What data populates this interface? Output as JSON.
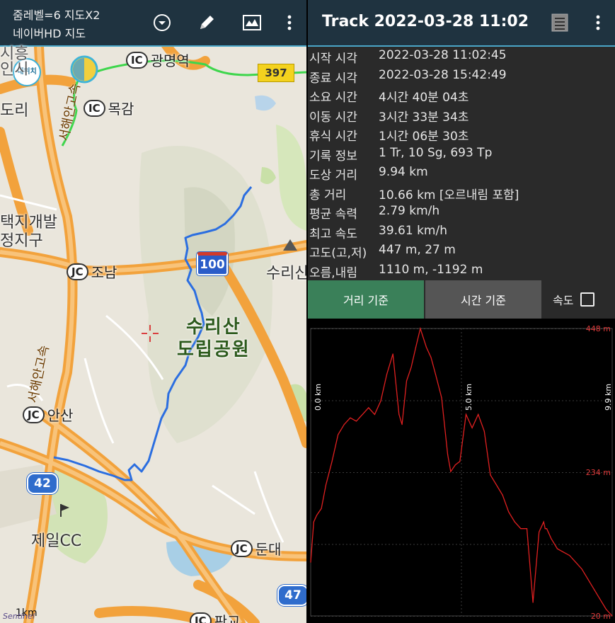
{
  "map": {
    "toolbar": {
      "zoom_text": "줌레벨=6 지도X2",
      "map_name": "네이버HD 지도",
      "icons": [
        "dropdown-circle-icon",
        "pencil-icon",
        "map-picture-icon",
        "more-vert-icon"
      ]
    },
    "my_location_label": "내위치",
    "labels": {
      "gwangmyeong_ic": "광명역",
      "mokgam_ic": "목감",
      "jonam_jc": "조남",
      "ansan_jc": "안산",
      "dundae_jc": "둔대",
      "pangyo_jc": "판교",
      "ic": "IC",
      "jc": "JC",
      "suri_park": "수리산\n도립공원",
      "suri_mountain": "수리산",
      "jeil_cc": "제일CC",
      "dev_zone": "택지개발\n정지구",
      "siheung": "시흥\n인시",
      "dori": "도리",
      "seohae_expressway_1": "서해안고속",
      "seohae_expressway_2": "서해안고속",
      "route_397": "397",
      "route_100": "100",
      "route_42": "42",
      "route_47": "47",
      "scale": "1km",
      "watermark": "Sentinel"
    }
  },
  "track": {
    "title": "Track 2022-03-28 11:02",
    "icons": [
      "list-document-icon",
      "more-vert-icon"
    ],
    "stats": [
      {
        "label": "시작 시각",
        "value": "2022-03-28 11:02:45"
      },
      {
        "label": "종료 시각",
        "value": "2022-03-28 15:42:49"
      },
      {
        "label": "소요 시간",
        "value": "4시간 40분 04초"
      },
      {
        "label": "이동 시간",
        "value": "3시간 33분 34초"
      },
      {
        "label": "휴식 시간",
        "value": "1시간 06분 30초"
      },
      {
        "label": "기록 정보",
        "value": "1 Tr, 10 Sg, 693 Tp"
      },
      {
        "label": "도상 거리",
        "value": "9.94 km"
      },
      {
        "label": "총 거리",
        "value": "10.66 km [오르내림 포함]"
      },
      {
        "label": "평균 속력",
        "value": "2.79 km/h"
      },
      {
        "label": "최고 속도",
        "value": "39.61 km/h"
      },
      {
        "label": "고도(고,저)",
        "value": "447 m, 27 m"
      },
      {
        "label": "오름,내림",
        "value": "1110 m, -1192 m"
      }
    ],
    "tabs": {
      "distance": "거리 기준",
      "time": "시간 기준",
      "speed": "속도",
      "speed_checked": false,
      "active": "distance"
    },
    "colors": {
      "accent": "#3a8059",
      "toolbar": "#1f3340",
      "line": "#e02020"
    }
  },
  "chart_data": {
    "type": "line",
    "title": "",
    "xlabel": "",
    "ylabel": "",
    "x_tick_labels": [
      "0.0 km",
      "5.0 km",
      "9.9 km"
    ],
    "y_tick_labels": [
      "448 m",
      "234 m",
      "20 m"
    ],
    "xlim": [
      0,
      9.9
    ],
    "ylim": [
      20,
      448
    ],
    "grid": true,
    "series": [
      {
        "x": [
          0.0,
          0.1,
          0.2,
          0.35,
          0.5,
          0.7,
          0.9,
          1.1,
          1.3,
          1.5,
          1.7,
          1.9,
          2.1,
          2.3,
          2.5,
          2.7,
          2.9,
          3.0,
          3.15,
          3.3,
          3.45,
          3.6,
          3.8,
          3.95,
          4.1,
          4.3,
          4.5,
          4.6,
          4.75,
          4.9,
          5.1,
          5.3,
          5.5,
          5.7,
          5.9,
          6.1,
          6.3,
          6.5,
          6.7,
          6.9,
          7.1,
          7.3,
          7.5,
          7.65,
          7.7,
          7.75,
          7.9,
          8.1,
          8.3,
          8.5,
          8.7,
          8.9,
          9.1,
          9.3,
          9.5,
          9.7,
          9.9
        ],
        "y": [
          100,
          160,
          170,
          180,
          215,
          250,
          290,
          305,
          315,
          310,
          320,
          330,
          320,
          340,
          380,
          410,
          320,
          305,
          370,
          390,
          420,
          448,
          420,
          405,
          380,
          345,
          260,
          235,
          245,
          250,
          320,
          300,
          320,
          295,
          230,
          215,
          200,
          175,
          160,
          150,
          150,
          40,
          145,
          160,
          150,
          150,
          135,
          120,
          115,
          110,
          100,
          90,
          75,
          60,
          45,
          30,
          20
        ]
      }
    ]
  }
}
